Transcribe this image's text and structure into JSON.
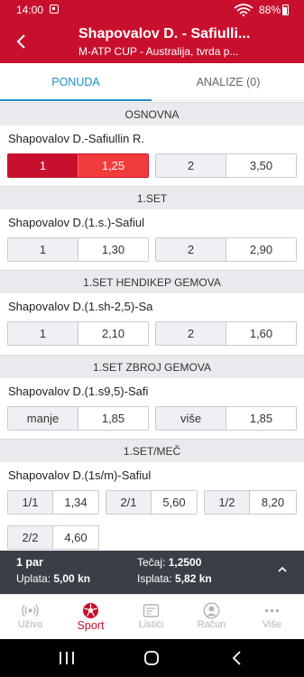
{
  "status": {
    "time": "14:00",
    "battery": "88%"
  },
  "header": {
    "title": "Shapovalov D. - Safiulli...",
    "subtitle": "M-ATP CUP - Australija, tvrda p..."
  },
  "tabs": [
    {
      "label": "PONUDA"
    },
    {
      "label": "ANALIZE (0)"
    }
  ],
  "markets": [
    {
      "heading": "OSNOVNA",
      "match": "Shapovalov D.-Safiullin R.",
      "odds": [
        {
          "label": "1",
          "value": "1,25",
          "selected": true
        },
        {
          "label": "2",
          "value": "3,50"
        }
      ]
    },
    {
      "heading": "1.SET",
      "match": "Shapovalov D.(1.s.)-Safiul",
      "odds": [
        {
          "label": "1",
          "value": "1,30"
        },
        {
          "label": "2",
          "value": "2,90"
        }
      ]
    },
    {
      "heading": "1.SET HENDIKEP GEMOVA",
      "match": "Shapovalov D.(1.sh-2,5)-Sa",
      "odds": [
        {
          "label": "1",
          "value": "2,10"
        },
        {
          "label": "2",
          "value": "1,60"
        }
      ]
    },
    {
      "heading": "1.SET ZBROJ GEMOVA",
      "match": "Shapovalov D.(1.s9,5)-Safi",
      "odds": [
        {
          "label": "manje",
          "value": "1,85"
        },
        {
          "label": "više",
          "value": "1,85"
        }
      ]
    },
    {
      "heading": "1.SET/MEČ",
      "match": "Shapovalov D.(1s/m)-Safiul",
      "odds": [
        {
          "label": "1/1",
          "value": "1,34"
        },
        {
          "label": "2/1",
          "value": "5,60"
        },
        {
          "label": "1/2",
          "value": "8,20"
        },
        {
          "label": "2/2",
          "value": "4,60"
        }
      ]
    }
  ],
  "betslip": {
    "count": "1 par",
    "stake_label": "Uplata:",
    "stake": "5,00 kn",
    "odds_label": "Tečaj:",
    "odds": "1,2500",
    "payout_label": "Isplata:",
    "payout": "5,82 kn"
  },
  "bottom_nav": [
    {
      "label": "Uživo",
      "icon": "live-icon"
    },
    {
      "label": "Sport",
      "icon": "football-icon",
      "active": true
    },
    {
      "label": "Listići",
      "icon": "tickets-icon"
    },
    {
      "label": "Račun",
      "icon": "account-icon"
    },
    {
      "label": "Više",
      "icon": "more-icon"
    }
  ],
  "colors": {
    "brand": "#c8102e",
    "accent": "#1d8ec7",
    "selected_value": "#f23b3b"
  }
}
